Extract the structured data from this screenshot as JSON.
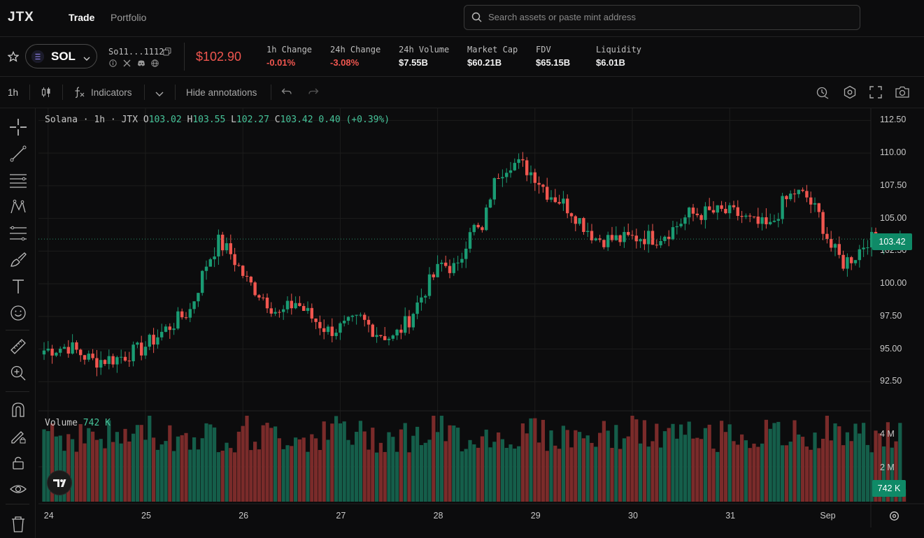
{
  "nav": {
    "logo": "JTX",
    "trade": "Trade",
    "portfolio": "Portfolio",
    "search_placeholder": "Search assets or paste mint address"
  },
  "token": {
    "symbol": "SOL",
    "mint": "So11...1112",
    "price": "$102.90",
    "stats": [
      {
        "label": "1h Change",
        "value": "-0.01%",
        "negative": true
      },
      {
        "label": "24h Change",
        "value": "-3.08%",
        "negative": true
      },
      {
        "label": "24h Volume",
        "value": "$7.55B",
        "negative": false
      },
      {
        "label": "Market Cap",
        "value": "$60.21B",
        "negative": false
      },
      {
        "label": "FDV",
        "value": "$65.15B",
        "negative": false
      },
      {
        "label": "Liquidity",
        "value": "$6.01B",
        "negative": false
      }
    ]
  },
  "toolbar": {
    "interval": "1h",
    "indicators": "Indicators",
    "hide_annotations": "Hide annotations"
  },
  "legend": {
    "title": "Solana · 1h · JTX",
    "o_label": "O",
    "o": "103.02",
    "h_label": "H",
    "h": "103.55",
    "l_label": "L",
    "l": "102.27",
    "c_label": "C",
    "c": "103.42",
    "change": "0.40 (+0.39%)",
    "volume_label": "Volume",
    "volume": "742 K"
  },
  "badges": {
    "last_price": "103.42",
    "volume": "742 K"
  },
  "colors": {
    "up": "#1a9b73",
    "down": "#f0564f",
    "vol_up": "#155e4a",
    "vol_down": "#7a2b2a",
    "accent": "#0f8a67"
  },
  "chart_data": {
    "type": "candlestick",
    "symbol": "Solana",
    "interval": "1h",
    "y_ticks": [
      "112.50",
      "110.00",
      "107.50",
      "105.00",
      "102.50",
      "100.00",
      "97.50",
      "95.00",
      "92.50"
    ],
    "ylim": [
      91.5,
      113.0
    ],
    "volume_ticks": [
      "4 M",
      "2 M"
    ],
    "x_ticks": [
      "24",
      "25",
      "26",
      "27",
      "28",
      "29",
      "30",
      "31",
      "Sep"
    ],
    "close_path": [
      [
        0,
        94.9
      ],
      [
        6,
        95.2
      ],
      [
        12,
        94.1
      ],
      [
        18,
        94.3
      ],
      [
        24,
        95.0
      ],
      [
        28,
        96.0
      ],
      [
        32,
        97.0
      ],
      [
        36,
        98.0
      ],
      [
        40,
        101.5
      ],
      [
        43,
        103.2
      ],
      [
        46,
        102.3
      ],
      [
        50,
        100.2
      ],
      [
        54,
        99.0
      ],
      [
        58,
        97.6
      ],
      [
        62,
        98.6
      ],
      [
        66,
        97.4
      ],
      [
        70,
        96.4
      ],
      [
        74,
        96.7
      ],
      [
        78,
        97.3
      ],
      [
        82,
        96.3
      ],
      [
        86,
        95.8
      ],
      [
        90,
        97.3
      ],
      [
        94,
        99.6
      ],
      [
        98,
        101.5
      ],
      [
        102,
        101.1
      ],
      [
        105,
        104.4
      ],
      [
        108,
        103.9
      ],
      [
        110,
        106.8
      ],
      [
        112,
        108.5
      ],
      [
        115,
        109.3
      ],
      [
        118,
        109.0
      ],
      [
        121,
        108.3
      ],
      [
        124,
        107.0
      ],
      [
        127,
        106.4
      ],
      [
        130,
        105.6
      ],
      [
        133,
        104.5
      ],
      [
        136,
        103.5
      ],
      [
        139,
        103.4
      ],
      [
        143,
        103.4
      ],
      [
        147,
        103.6
      ],
      [
        151,
        103.5
      ],
      [
        155,
        104.2
      ],
      [
        159,
        105.3
      ],
      [
        163,
        105.4
      ],
      [
        167,
        105.5
      ],
      [
        171,
        105.3
      ],
      [
        175,
        104.6
      ],
      [
        179,
        104.3
      ],
      [
        182,
        106.1
      ],
      [
        185,
        107.0
      ],
      [
        188,
        106.6
      ],
      [
        191,
        105.2
      ],
      [
        194,
        102.8
      ],
      [
        197,
        101.6
      ],
      [
        200,
        102.2
      ],
      [
        203,
        103.4
      ],
      [
        206,
        103.3
      ],
      [
        209,
        103.0
      ],
      [
        212,
        103.4
      ]
    ],
    "volume_range_millions": [
      0.7,
      5.1
    ],
    "last_price": 103.42,
    "last_volume": "742 K"
  }
}
